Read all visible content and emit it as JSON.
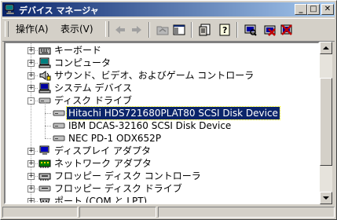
{
  "window": {
    "title": "デバイス マネージャ"
  },
  "menu": {
    "action": "操作(A)",
    "view": "表示(V)"
  },
  "tree": [
    {
      "label": "キーボード",
      "icon": "keyboard-icon",
      "expander": "+"
    },
    {
      "label": "コンピュータ",
      "icon": "computer-icon",
      "expander": "+"
    },
    {
      "label": "サウンド、ビデオ、およびゲーム コントローラ",
      "icon": "sound-icon",
      "expander": "+"
    },
    {
      "label": "システム デバイス",
      "icon": "system-device-icon",
      "expander": "+"
    },
    {
      "label": "ディスク ドライブ",
      "icon": "disk-drive-icon",
      "expander": "-"
    },
    {
      "label": "Hitachi HDS721680PLAT80 SCSI Disk Device",
      "icon": "disk-icon",
      "selected": true
    },
    {
      "label": "IBM DCAS-32160 SCSI Disk Device",
      "icon": "disk-icon"
    },
    {
      "label": "NEC PD-1 ODX652P",
      "icon": "disk-icon"
    },
    {
      "label": "ディスプレイ アダプタ",
      "icon": "display-adapter-icon",
      "expander": "+"
    },
    {
      "label": "ネットワーク アダプタ",
      "icon": "network-adapter-icon",
      "expander": "+"
    },
    {
      "label": "フロッピー ディスク コントローラ",
      "icon": "floppy-controller-icon",
      "expander": "+"
    },
    {
      "label": "フロッピー ディスク ドライブ",
      "icon": "floppy-drive-icon",
      "expander": "+"
    },
    {
      "label": "ポート (COM と LPT)",
      "icon": "port-icon",
      "expander": "+"
    }
  ],
  "colors": {
    "title_start": "#0a246a",
    "title_end": "#a6caf0",
    "selection": "#0a246a",
    "face": "#d4d0c8"
  }
}
